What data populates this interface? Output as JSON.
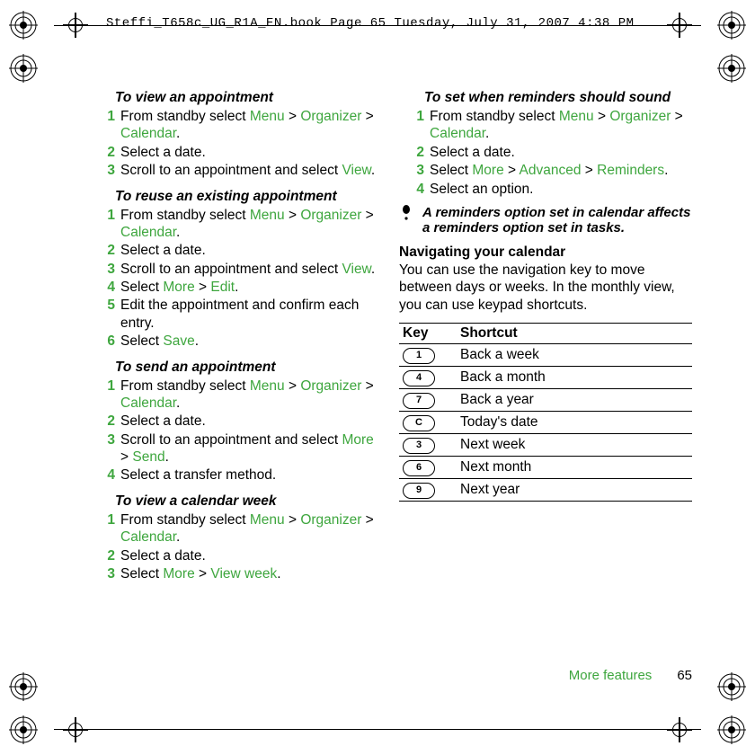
{
  "header": "Steffi_T658c_UG_R1A_EN.book  Page 65  Tuesday, July 31, 2007  4:38 PM",
  "footer": {
    "section": "More features",
    "page": "65"
  },
  "nav": {
    "from_standby_select": "From standby select ",
    "select_date": "Select a date.",
    "scroll_select_view_a": "Scroll to an appointment and select ",
    "view": "View",
    "menu": "Menu",
    "organizer": "Organizer",
    "calendar": "Calendar",
    "gt": " > ",
    "dot": "."
  },
  "left": {
    "h1": "To view an appointment",
    "h2": "To reuse an existing appointment",
    "s4a": "Select ",
    "more": "More",
    "edit": "Edit",
    "s5": "Edit the appointment and confirm each entry.",
    "s6a": "Select ",
    "save": "Save",
    "h3": "To send an appointment",
    "scroll_more_send_a": "Scroll to an appointment and select ",
    "send": "Send",
    "s4b": "Select a transfer method.",
    "h4": "To view a calendar week",
    "s3b": "Select ",
    "view_week": "View week"
  },
  "right": {
    "h1": "To set when reminders should sound",
    "s3a": "Select ",
    "advanced": "Advanced",
    "reminders": "Reminders",
    "s4": "Select an option.",
    "note": "A reminders option set in calendar affects a reminders option set in tasks.",
    "nav_title": "Navigating your calendar",
    "nav_body": "You can use the navigation key to move between days or weeks. In the monthly view, you can use keypad shortcuts."
  },
  "table": {
    "col1": "Key",
    "col2": "Shortcut",
    "rows": [
      {
        "key": "1",
        "label": "Back a week"
      },
      {
        "key": "4",
        "label": "Back a month"
      },
      {
        "key": "7",
        "label": "Back a year"
      },
      {
        "key": "C",
        "label": "Today's date"
      },
      {
        "key": "3",
        "label": "Next week"
      },
      {
        "key": "6",
        "label": "Next month"
      },
      {
        "key": "9",
        "label": "Next year"
      }
    ]
  }
}
